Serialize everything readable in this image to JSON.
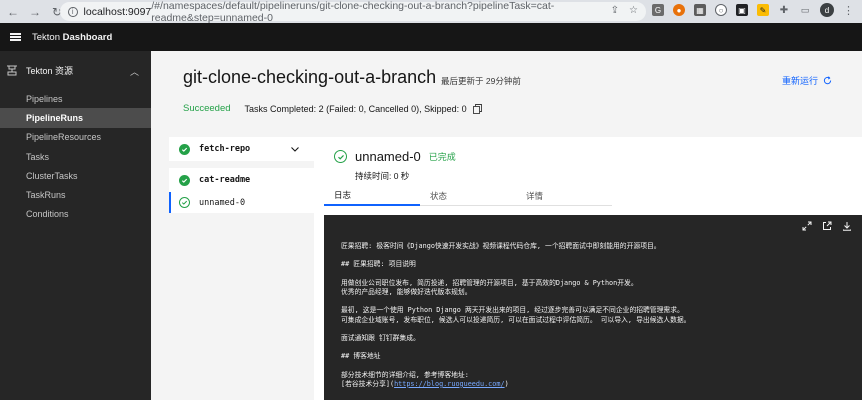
{
  "browser": {
    "url_host": "localhost:9097",
    "url_path": "/#/namespaces/default/pipelineruns/git-clone-checking-out-a-branch?pipelineTask=cat-readme&step=unnamed-0",
    "profile_initial": "d"
  },
  "app": {
    "brand_prefix": "Tekton",
    "brand_name": "Dashboard"
  },
  "sidebar": {
    "section_title": "Tekton 资源",
    "items": [
      {
        "label": "Pipelines"
      },
      {
        "label": "PipelineRuns"
      },
      {
        "label": "PipelineResources"
      },
      {
        "label": "Tasks"
      },
      {
        "label": "ClusterTasks"
      },
      {
        "label": "TaskRuns"
      },
      {
        "label": "Conditions"
      }
    ],
    "active_index": 1
  },
  "run": {
    "title": "git-clone-checking-out-a-branch",
    "updated": "最后更新于 29分钟前",
    "rerun_label": "重新运行",
    "status": "Succeeded",
    "tasks_summary": "Tasks Completed: 2 (Failed: 0, Cancelled 0), Skipped: 0"
  },
  "tasks": [
    {
      "name": "fetch-repo",
      "expanded": false
    },
    {
      "name": "cat-readme",
      "expanded": true,
      "steps": [
        {
          "name": "unnamed-0",
          "selected": true
        }
      ]
    }
  ],
  "step": {
    "name": "unnamed-0",
    "status_label": "已完成",
    "duration": "持续时间:  0 秒",
    "tabs": [
      {
        "label": "日志",
        "active": true
      },
      {
        "label": "状态",
        "active": false
      },
      {
        "label": "详情",
        "active": false
      }
    ]
  },
  "log": {
    "lines": [
      "匠果招聘: 极客时间《Django快速开发实战》视频课程代码仓库, 一个招聘面试中即刻能用的开源项目。",
      "",
      "## 匠果招聘: 项目说明",
      "",
      "用做创业公司职位发布, 简历投递, 招聘管理的开源项目, 基于高效的Django & Python开发。",
      "优秀的产品经理, 能够做好迭代版本规划。",
      "",
      "最初, 这是一个使用 Python Django 两天开发出来的项目, 经过逐步完善可以满足不同企业的招聘管理需求。",
      "可集成企业域账号, 发布职位, 候选人可以投递简历, 可以在面试过程中评估简历。 可以导入, 导出候选人数据。",
      "",
      "面试通知跟 钉钉群集成。",
      "",
      "## 博客地址",
      "",
      "部分技术细节的详细介绍, 参考博客地址:"
    ],
    "link_prefix": "[若谷技术分享](",
    "link_text": "https://blog.ruogueedu.com/",
    "link_suffix": ")"
  },
  "colors": {
    "success": "#24a148",
    "link": "#0f62fe",
    "sidebar_bg": "#262626",
    "header_bg": "#161616",
    "log_bg": "#262626"
  }
}
